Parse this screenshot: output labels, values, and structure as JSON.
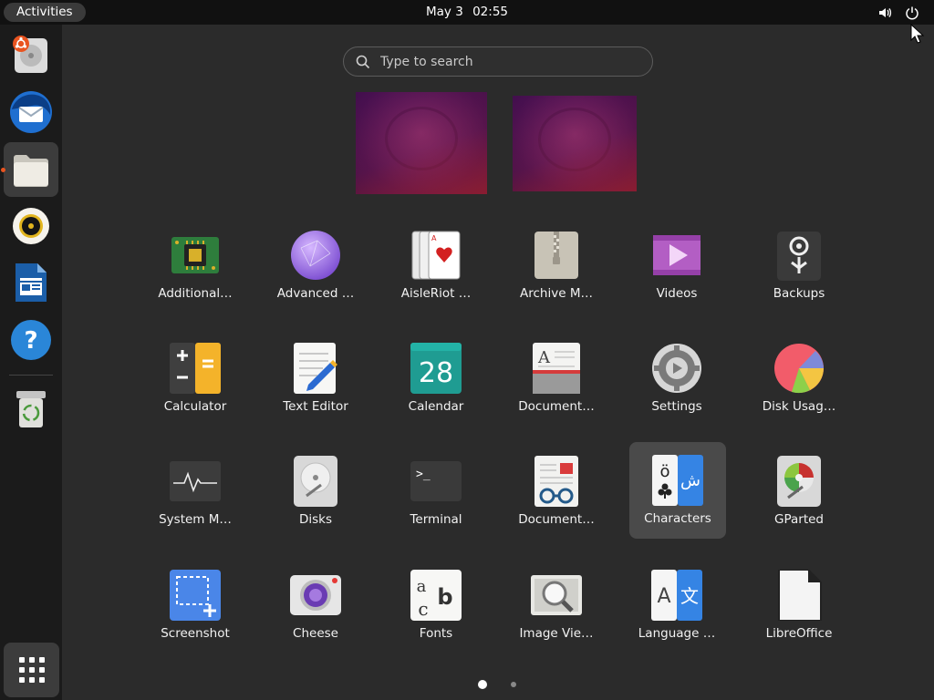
{
  "topbar": {
    "activities_label": "Activities",
    "date": "May 3",
    "time": "02:55",
    "tray_icons": [
      "volume-icon",
      "power-icon"
    ]
  },
  "dock": {
    "items": [
      {
        "name": "ubuntu-installer",
        "icon": "disk-installer-icon"
      },
      {
        "name": "thunderbird",
        "icon": "thunderbird-icon"
      },
      {
        "name": "files",
        "icon": "files-icon",
        "running": true
      },
      {
        "name": "rhythmbox",
        "icon": "rhythmbox-icon"
      },
      {
        "name": "libreoffice-writer",
        "icon": "writer-icon"
      },
      {
        "name": "help",
        "icon": "help-icon"
      },
      {
        "name": "trash",
        "icon": "trash-icon"
      }
    ],
    "show_apps_icon": "app-grid-icon"
  },
  "search": {
    "placeholder": "Type to search"
  },
  "workspaces": {
    "count": 2
  },
  "apps": [
    {
      "label": "Additional…",
      "icon": "additional-drivers-icon"
    },
    {
      "label": "Advanced …",
      "icon": "advanced-network-icon"
    },
    {
      "label": "AisleRiot …",
      "icon": "aisleriot-cards-icon"
    },
    {
      "label": "Archive M…",
      "icon": "archive-manager-icon"
    },
    {
      "label": "Videos",
      "icon": "videos-icon"
    },
    {
      "label": "Backups",
      "icon": "backups-icon"
    },
    {
      "label": "Calculator",
      "icon": "calculator-icon"
    },
    {
      "label": "Text Editor",
      "icon": "text-editor-icon"
    },
    {
      "label": "Calendar",
      "icon": "calendar-icon",
      "icon_text": "28"
    },
    {
      "label": "Document…",
      "icon": "document-scanner-icon",
      "icon_text": "A"
    },
    {
      "label": "Settings",
      "icon": "settings-icon"
    },
    {
      "label": "Disk Usag…",
      "icon": "disk-usage-icon"
    },
    {
      "label": "System M…",
      "icon": "system-monitor-icon"
    },
    {
      "label": "Disks",
      "icon": "disks-icon"
    },
    {
      "label": "Terminal",
      "icon": "terminal-icon",
      "icon_text": ">_"
    },
    {
      "label": "Document…",
      "icon": "document-viewer-icon"
    },
    {
      "label": "Characters",
      "icon": "characters-icon",
      "selected": true,
      "icon_text": "ö",
      "icon_text_2": "ش"
    },
    {
      "label": "GParted",
      "icon": "gparted-icon"
    },
    {
      "label": "Screenshot",
      "icon": "screenshot-icon"
    },
    {
      "label": "Cheese",
      "icon": "cheese-icon"
    },
    {
      "label": "Fonts",
      "icon": "fonts-icon",
      "icon_text": "a",
      "icon_text_2": "b",
      "icon_text_3": "c"
    },
    {
      "label": "Image Vie…",
      "icon": "image-viewer-icon"
    },
    {
      "label": "Language …",
      "icon": "language-support-icon",
      "icon_text": "A",
      "icon_text_2": "文"
    },
    {
      "label": "LibreOffice",
      "icon": "libreoffice-icon"
    }
  ],
  "pagination": {
    "pages": 2,
    "current": 1
  },
  "colors": {
    "background": "#2b2b2b",
    "topbar": "#111111",
    "dock": "#1b1b1b",
    "accent": "#e95420",
    "selected_tile": "#4a4a4a"
  }
}
